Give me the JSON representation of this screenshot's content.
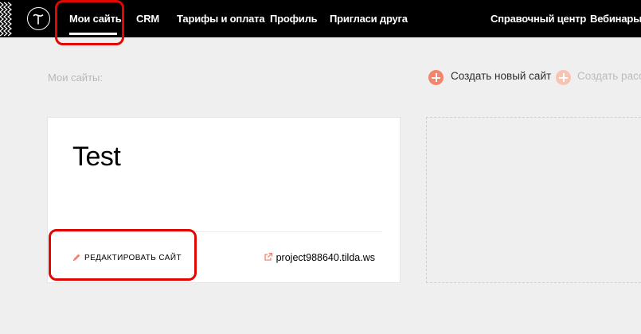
{
  "nav": {
    "items": [
      {
        "label": "Мои сайты"
      },
      {
        "label": "CRM"
      },
      {
        "label": "Тарифы и оплата"
      },
      {
        "label": "Профиль"
      },
      {
        "label": "Пригласи друга"
      }
    ],
    "right_items": [
      {
        "label": "Справочный центр"
      },
      {
        "label": "Вебинары"
      }
    ],
    "active": "Мои сайты"
  },
  "page": {
    "label": "Мои сайты:"
  },
  "actions": {
    "create_site": "Создать новый сайт",
    "create_newsletter": "Создать расс"
  },
  "site_card": {
    "title": "Test",
    "edit_label": "РЕДАКТИРОВАТЬ САЙТ",
    "url": "project988640.tilda.ws"
  },
  "colors": {
    "accent": "#f4846c",
    "accent_light": "#f9c3b4",
    "highlight": "#e10600",
    "topbar": "#000000"
  },
  "icons": {
    "logo": "tilda-logo-icon",
    "edit": "pencil-icon",
    "external": "external-link-icon",
    "add": "plus-circle-icon"
  }
}
